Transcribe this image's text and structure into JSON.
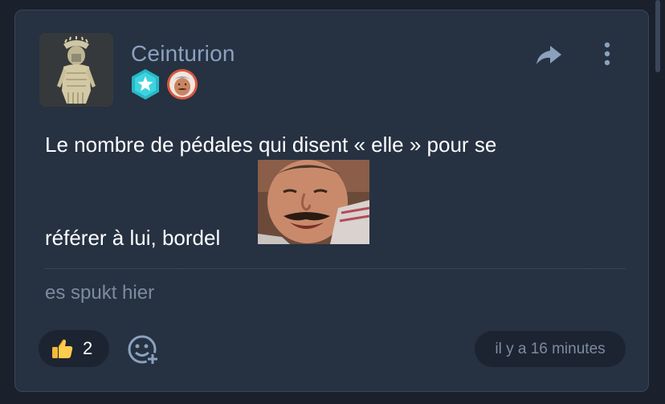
{
  "post": {
    "author": {
      "username": "Ceinturion",
      "avatar": "roman-centurion-statue-avatar",
      "badges": [
        {
          "name": "star-hexagon-badge",
          "color": "#2fc7d4"
        },
        {
          "name": "risitas-face-badge",
          "color": "#d9583f"
        }
      ]
    },
    "actions": {
      "share_icon": "share-arrow-icon",
      "more_icon": "vertical-dots-icon"
    },
    "body": {
      "line1": "Le nombre de pédales qui disent « elle » pour se",
      "line2": "référer à lui, bordel",
      "sticker": "risitas-laughing-sticker"
    },
    "signature": "es spukt hier",
    "reactions": [
      {
        "icon": "thumbs-up-icon",
        "count": "2"
      }
    ],
    "add_reaction_icon": "add-reaction-face-icon",
    "timestamp": "il y a 16 minutes"
  },
  "colors": {
    "background": "#1a212d",
    "card": "#263142",
    "username": "#8ba1be",
    "muted": "#7d8ba0",
    "pill": "#1c2431",
    "text": "#ffffff"
  }
}
